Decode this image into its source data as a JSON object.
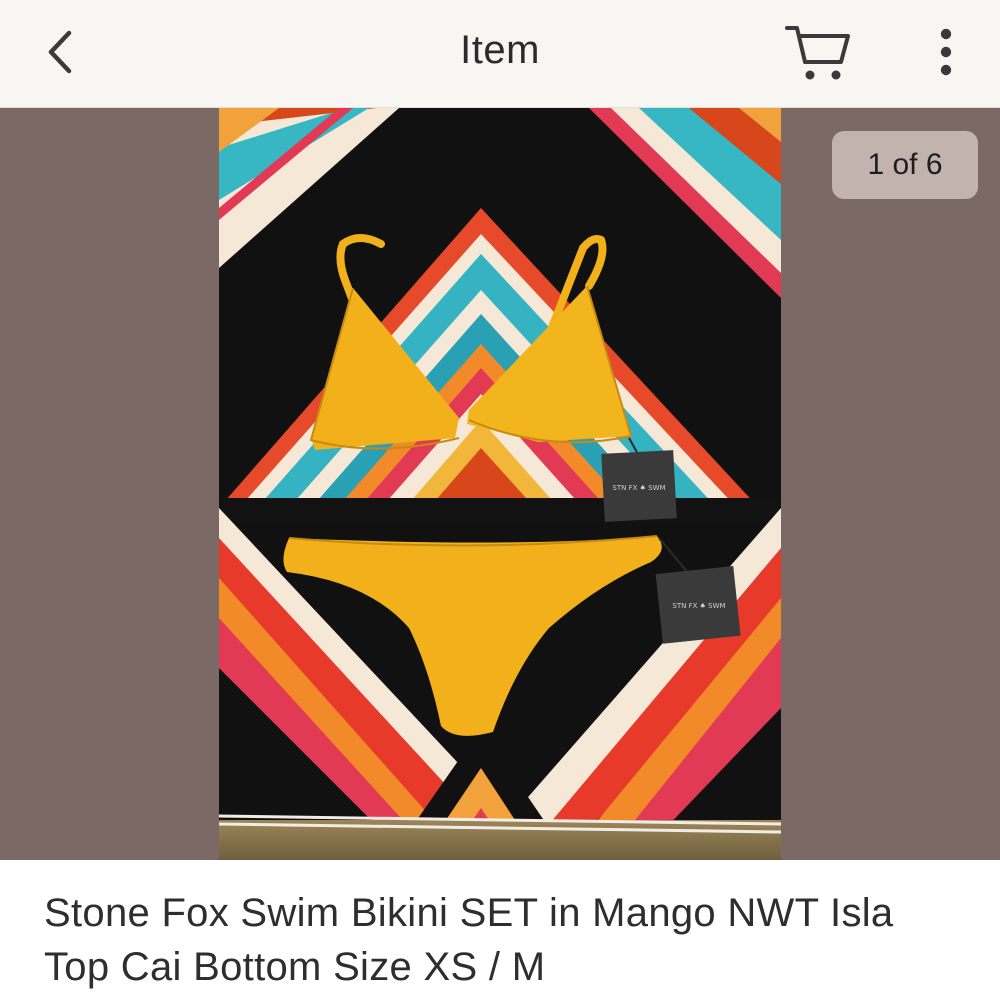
{
  "header": {
    "title": "Item",
    "back_icon": "chevron-left-icon",
    "cart_icon": "shopping-cart-icon",
    "more_icon": "vertical-ellipsis-icon"
  },
  "gallery": {
    "counter": "1 of 6",
    "current_index": 1,
    "total_images": 6,
    "image_subject": "yellow bikini top and bottom with hang tags on a striped blanket",
    "tag_text_top": "STN FX ♠ SWM",
    "tag_text_bottom": "STN FX ♠ SWM"
  },
  "listing": {
    "title": "Stone Fox Swim Bikini SET in Mango NWT Isla Top Cai Bottom Size XS / M"
  },
  "colors": {
    "nav_background": "#f7f6f3",
    "carousel_background": "#7a6965",
    "bikini": "#f2b11a",
    "text": "#2e2e2e"
  }
}
